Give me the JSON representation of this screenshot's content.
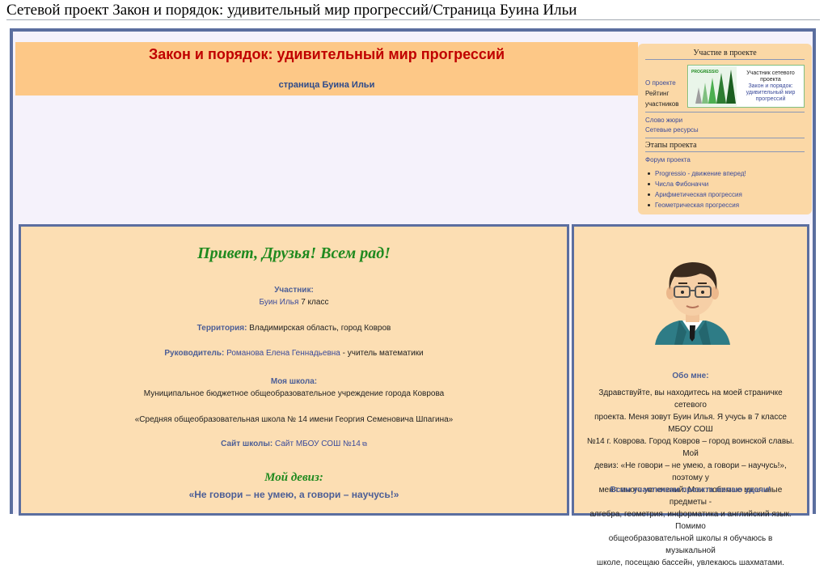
{
  "page": {
    "title": "Сетевой проект Закон и порядок: удивительный мир прогрессий/Страница Буина Ильи"
  },
  "banner": {
    "title": "Закон и порядок: удивительный мир прогрессий",
    "subtitle": "страница Буина Ильи"
  },
  "sidebar": {
    "heading": "Участие в проекте",
    "about_link": "О проекте",
    "rating_line1": "Рейтинг",
    "rating_line2": "участников",
    "badge": {
      "line1": "Участник сетевого",
      "line2": "проекта",
      "line3": "Закон и порядок:",
      "line4": "удивительный мир",
      "line5": "прогрессий",
      "logo_text": "PROGRESSIO"
    },
    "jury_link": "Слово жюри",
    "resources_link": "Сетевые ресурсы",
    "stages_heading": "Этапы проекта",
    "forum_link": "Форум проекта",
    "stages": [
      "Progressio - движение вперед!",
      "Числа Фибоначчи",
      "Арифметическая прогрессия",
      "Геометрическая прогрессия"
    ]
  },
  "main": {
    "greeting": "Привет, Друзья! Всем рад!",
    "participant_label": "Участник:",
    "participant_name": "Буин Илья",
    "participant_class": " 7 класс",
    "territory_label": "Территория:",
    "territory_value": " Владимирская область, город Ковров",
    "supervisor_label": "Руководитель:",
    "supervisor_name": " Романова Елена Геннадьевна",
    "supervisor_role": " - учитель математики",
    "school_label": "Моя школа:",
    "school_line1": "Муниципальное бюджетное общеобразовательное учреждение города Коврова",
    "school_line2": "«Средняя общеобразовательная школа № 14 имени Георгия Семеновича Шпагина»",
    "site_label": "Сайт школы:",
    "site_link": " Сайт МБОУ СОШ №14",
    "motto_heading": "Мой девиз:",
    "motto": "«Не говори – не умею, а говори – научусь!»"
  },
  "about": {
    "heading": "Обо мне:",
    "lines": [
      "Здравствуйте, вы находитесь на моей страничке сетевого",
      "проекта. Меня зовут Буин Илья. Я учусь в 7 классе МБОУ СОШ",
      "№14 г. Коврова. Город Ковров – город воинской славы. Мой",
      "девиз: «Не говори – не умею, а говори – научусь!», поэтому у",
      "меня много увлечений. Мои любимые школьные предметы -",
      "алгебра, геометрия, информатика и английский язык. Помимо",
      "общеобразовательной школы я обучаюсь в музыкальной",
      "школе, посещаю бассейн, увлекаюсь шахматами."
    ],
    "wish": "Всем участникам проекта желаю удачи!"
  },
  "colors": {
    "banner_bg": "#fdc887",
    "title_red": "#c00000",
    "frame_blue": "#5b6e9f",
    "box_bg": "#fcdeb3",
    "green": "#1f8a1f",
    "link_blue": "#3b4b9b"
  },
  "icons": {
    "external_link": "external-link-icon",
    "avatar": "boy-avatar-image",
    "badge_logo": "progressio-arrows-logo"
  }
}
